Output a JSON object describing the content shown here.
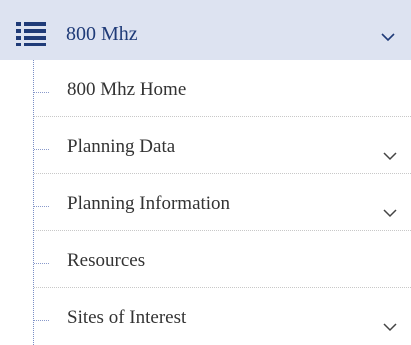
{
  "header": {
    "label": "800 Mhz",
    "icon": "list-icon",
    "expanded": true,
    "chevron_icon": "chevron-down-icon"
  },
  "items": [
    {
      "label": "800 Mhz Home",
      "has_submenu": false
    },
    {
      "label": "Planning Data",
      "has_submenu": true,
      "chevron_icon": "chevron-down-icon"
    },
    {
      "label": "Planning Information",
      "has_submenu": true,
      "chevron_icon": "chevron-down-icon"
    },
    {
      "label": "Resources",
      "has_submenu": false
    },
    {
      "label": "Sites of Interest",
      "has_submenu": true,
      "chevron_icon": "chevron-down-icon"
    }
  ],
  "colors": {
    "header_background": "#dde3f1",
    "accent": "#1f3b78",
    "text": "#333333",
    "tree_line": "#7a8fc6"
  }
}
